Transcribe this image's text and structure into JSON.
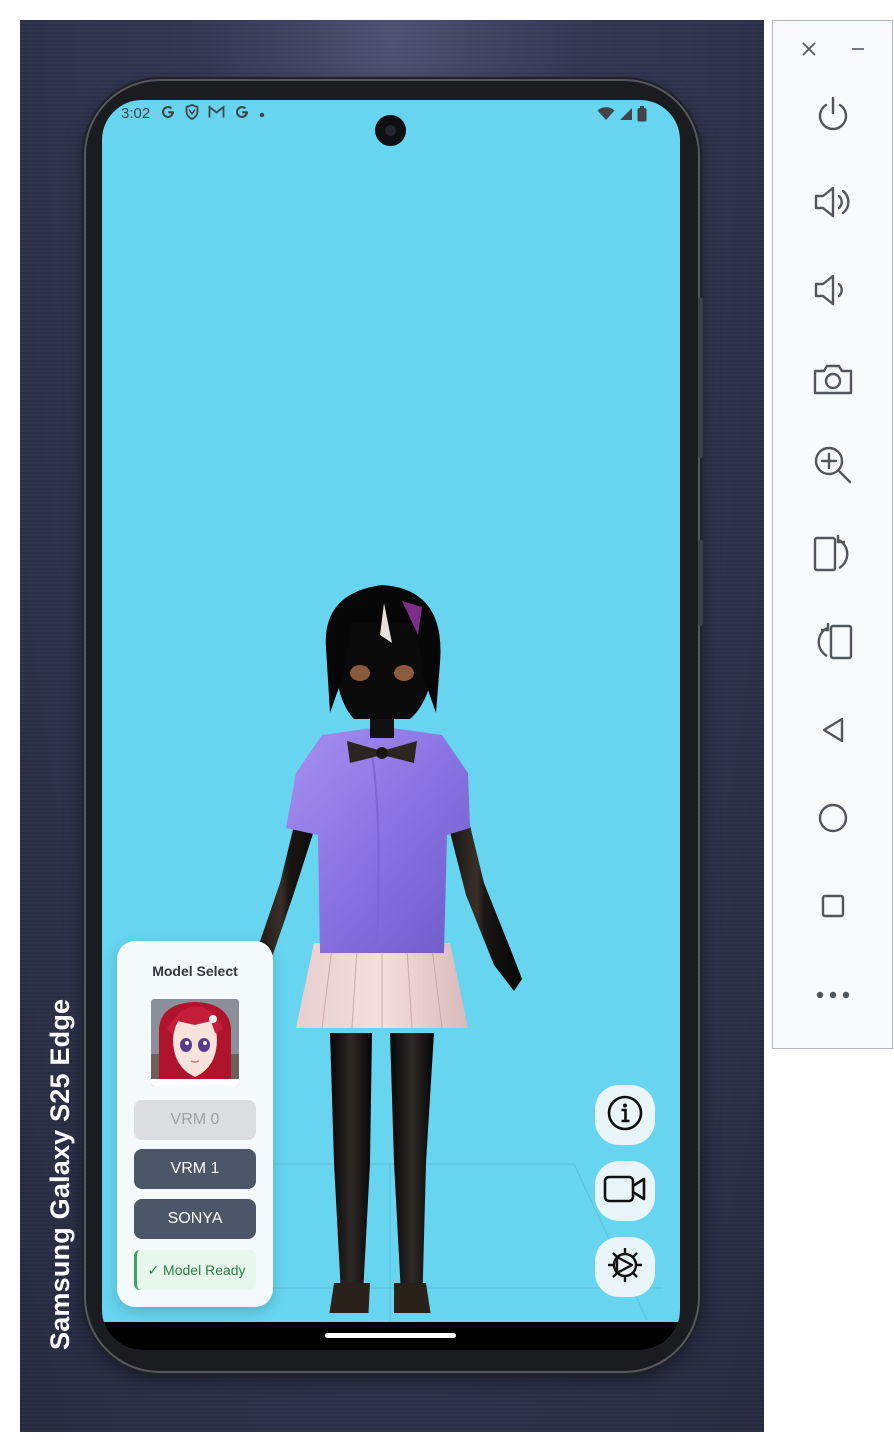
{
  "device": {
    "brand_label": "Samsung Galaxy  S25  Edge"
  },
  "status_bar": {
    "time": "3:02",
    "notification_icons": [
      "google-g-icon",
      "shield-icon",
      "gmail-icon",
      "google-g-icon",
      "dot-icon"
    ],
    "right_icons": [
      "wifi-icon",
      "cell-signal-icon",
      "battery-icon"
    ]
  },
  "model_panel": {
    "title": "Model Select",
    "buttons": [
      {
        "label": "VRM 0",
        "state": "disabled"
      },
      {
        "label": "VRM 1",
        "state": "enabled"
      },
      {
        "label": "SONYA",
        "state": "enabled"
      }
    ],
    "status": "✓ Model Ready"
  },
  "fabs": [
    "info-icon",
    "video-camera-icon",
    "settings-gear-icon"
  ],
  "emulator_toolbar": {
    "top": [
      "close-icon",
      "minimize-icon"
    ],
    "buttons": [
      "power-icon",
      "volume-up-icon",
      "volume-down-icon",
      "camera-icon",
      "zoom-in-icon",
      "rotate-right-icon",
      "rotate-left-icon",
      "back-icon",
      "home-icon",
      "overview-icon",
      "more-icon"
    ]
  },
  "colors": {
    "viewport_bg": "#67d5f0",
    "panel_button": "#4d5568",
    "ready_green": "#2a7d45",
    "frame_bg": "#2d3249"
  }
}
